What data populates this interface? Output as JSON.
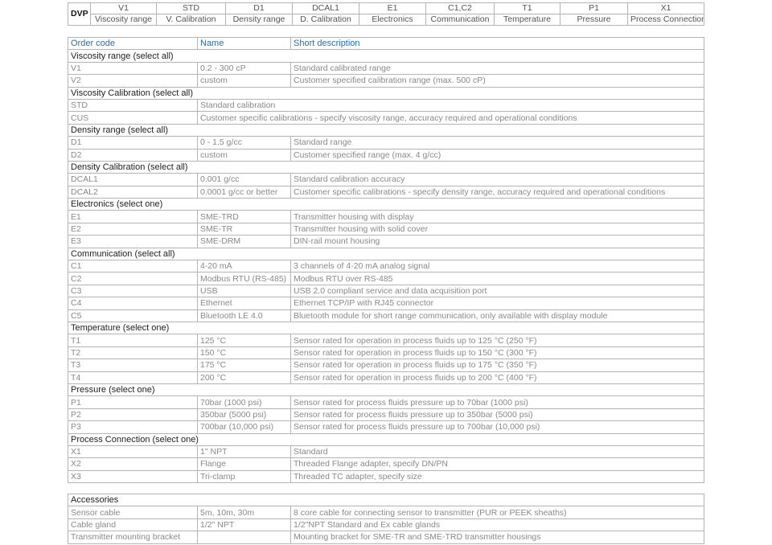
{
  "code_strip": {
    "prefix": "DVP",
    "columns": [
      {
        "code": "V1",
        "label": "Viscosity range"
      },
      {
        "code": "STD",
        "label": "V. Calibration"
      },
      {
        "code": "D1",
        "label": "Density range"
      },
      {
        "code": "DCAL1",
        "label": "D. Calibration"
      },
      {
        "code": "E1",
        "label": "Electronics"
      },
      {
        "code": "C1,C2",
        "label": "Communication"
      },
      {
        "code": "T1",
        "label": "Temperature"
      },
      {
        "code": "P1",
        "label": "Pressure"
      },
      {
        "code": "X1",
        "label": "Process Connection"
      }
    ]
  },
  "options_table": {
    "headers": {
      "code": "Order code",
      "name": "Name",
      "desc": "Short description"
    },
    "sections": [
      {
        "title": "Viscosity range (select all)",
        "rows": [
          {
            "code": "V1",
            "name": "0.2 - 300 cP",
            "desc": "Standard calibrated range"
          },
          {
            "code": "V2",
            "name": "custom",
            "desc": "Customer specified calibration range (max. 500 cP)"
          }
        ]
      },
      {
        "title": "Viscosity Calibration (select all)",
        "rows": [
          {
            "code": "STD",
            "name": "Standard calibration",
            "desc": ""
          },
          {
            "code": "CUS",
            "name": "Customer specific calibrations - specify viscosity range, accuracy required and operational conditions",
            "desc": ""
          }
        ]
      },
      {
        "title": "Density range (select all)",
        "rows": [
          {
            "code": "D1",
            "name": "0 - 1.5 g/cc",
            "desc": "Standard range"
          },
          {
            "code": "D2",
            "name": "custom",
            "desc": "Customer specified range  (max. 4 g/cc)"
          }
        ]
      },
      {
        "title": "Density Calibration (select all)",
        "rows": [
          {
            "code": "DCAL1",
            "name": "0.001 g/cc",
            "desc": "Standard calibration accuracy"
          },
          {
            "code": "DCAL2",
            "name": "0.0001 g/cc or better",
            "desc": "Customer specific calibrations - specify density range, accuracy required and operational conditions"
          }
        ]
      },
      {
        "title": "Electronics (select one)",
        "rows": [
          {
            "code": "E1",
            "name": "SME-TRD",
            "desc": "Transmitter housing with display"
          },
          {
            "code": "E2",
            "name": "SME-TR",
            "desc": "Transmitter housing with solid cover"
          },
          {
            "code": "E3",
            "name": "SME-DRM",
            "desc": "DIN-rail mount housing"
          }
        ]
      },
      {
        "title": "Communication (select all)",
        "rows": [
          {
            "code": "C1",
            "name": "4-20 mA",
            "desc": "3 channels of 4-20 mA analog signal"
          },
          {
            "code": "C2",
            "name": "Modbus RTU (RS-485)",
            "desc": "Modbus RTU over RS-485"
          },
          {
            "code": "C3",
            "name": "USB",
            "desc": "USB 2.0 compliant service and data acquisition port"
          },
          {
            "code": "C4",
            "name": "Ethernet",
            "desc": "Ethernet TCP/IP with RJ45 connector"
          },
          {
            "code": "C5",
            "name": "Bluetooth LE 4.0",
            "desc": "Bluetooth module for short range communication, only available with display module"
          }
        ]
      },
      {
        "title": "Temperature (select one)",
        "rows": [
          {
            "code": "T1",
            "name": "125 °C",
            "desc": "Sensor rated for operation in process fluids up to 125 °C (250 °F)"
          },
          {
            "code": "T2",
            "name": "150 °C",
            "desc": "Sensor rated for operation in process fluids up to 150 °C (300 °F)"
          },
          {
            "code": "T3",
            "name": "175 °C",
            "desc": "Sensor rated for operation in process fluids up to 175 °C (350 °F)"
          },
          {
            "code": "T4",
            "name": "200 °C",
            "desc": "Sensor rated for operation in process fluids up to 200 °C (400 °F)"
          }
        ]
      },
      {
        "title": "Pressure (select one)",
        "rows": [
          {
            "code": "P1",
            "name": "70bar (1000 psi)",
            "desc": "Sensor rated for process fluids pressure up to 70bar (1000 psi)"
          },
          {
            "code": "P2",
            "name": "350bar (5000 psi)",
            "desc": "Sensor rated for process fluids pressure up to 350bar (5000 psi)"
          },
          {
            "code": "P3",
            "name": "700bar (10,000 psi)",
            "desc": "Sensor rated for process fluids pressure up to 700bar (10,000 psi)"
          }
        ]
      },
      {
        "title": "Process Connection (select one)",
        "rows": [
          {
            "code": "X1",
            "name": "1\" NPT",
            "desc": "Standard"
          },
          {
            "code": "X2",
            "name": "Flange",
            "desc": "Threaded Flange adapter, specify DN/PN"
          },
          {
            "code": "X3",
            "name": "Tri-clamp",
            "desc": "Threaded TC adapter, specify size"
          }
        ]
      }
    ]
  },
  "accessories": {
    "title": "Accessories",
    "rows": [
      {
        "code": "Sensor cable",
        "name": "5m, 10m, 30m",
        "desc": "8 core cable for connecting sensor to transmitter (PUR or PEEK sheaths)"
      },
      {
        "code": "Cable gland",
        "name": "1/2\" NPT",
        "desc": "1/2\"NPT Standard and Ex cable glands"
      },
      {
        "code": "Transmitter mounting bracket",
        "name": "",
        "desc": "Mounting bracket for SME-TR and SME-TRD transmitter housings"
      }
    ]
  }
}
